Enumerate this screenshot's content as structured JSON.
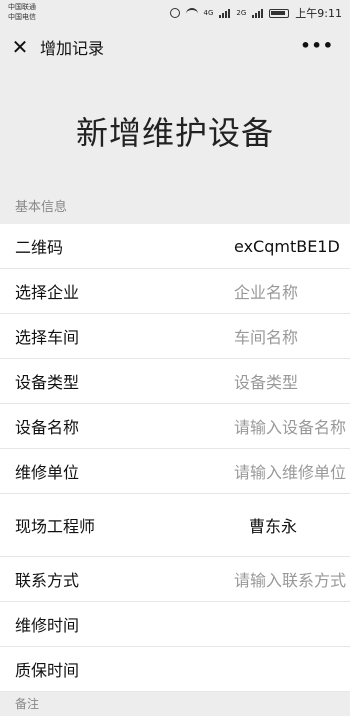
{
  "status_bar": {
    "carrier1": "中国联通",
    "carrier2": "中国电信",
    "time": "上午9:11",
    "network1": "4G",
    "network2": "2G"
  },
  "nav": {
    "title": "增加记录"
  },
  "hero_title": "新增维护设备",
  "section_label": "基本信息",
  "fields": {
    "qr_code": {
      "label": "二维码",
      "value": "exCqmtBE1D"
    },
    "company": {
      "label": "选择企业",
      "placeholder": "企业名称"
    },
    "workshop": {
      "label": "选择车间",
      "placeholder": "车间名称"
    },
    "device_type": {
      "label": "设备类型",
      "placeholder": "设备类型"
    },
    "device_name": {
      "label": "设备名称",
      "placeholder": "请输入设备名称"
    },
    "repair_unit": {
      "label": "维修单位",
      "placeholder": "请输入维修单位"
    },
    "engineer": {
      "label": "现场工程师",
      "value": "曹东永"
    },
    "contact": {
      "label": "联系方式",
      "placeholder": "请输入联系方式"
    },
    "repair_time": {
      "label": "维修时间"
    },
    "warranty_time": {
      "label": "质保时间"
    }
  },
  "bottom_section_label": "备注"
}
